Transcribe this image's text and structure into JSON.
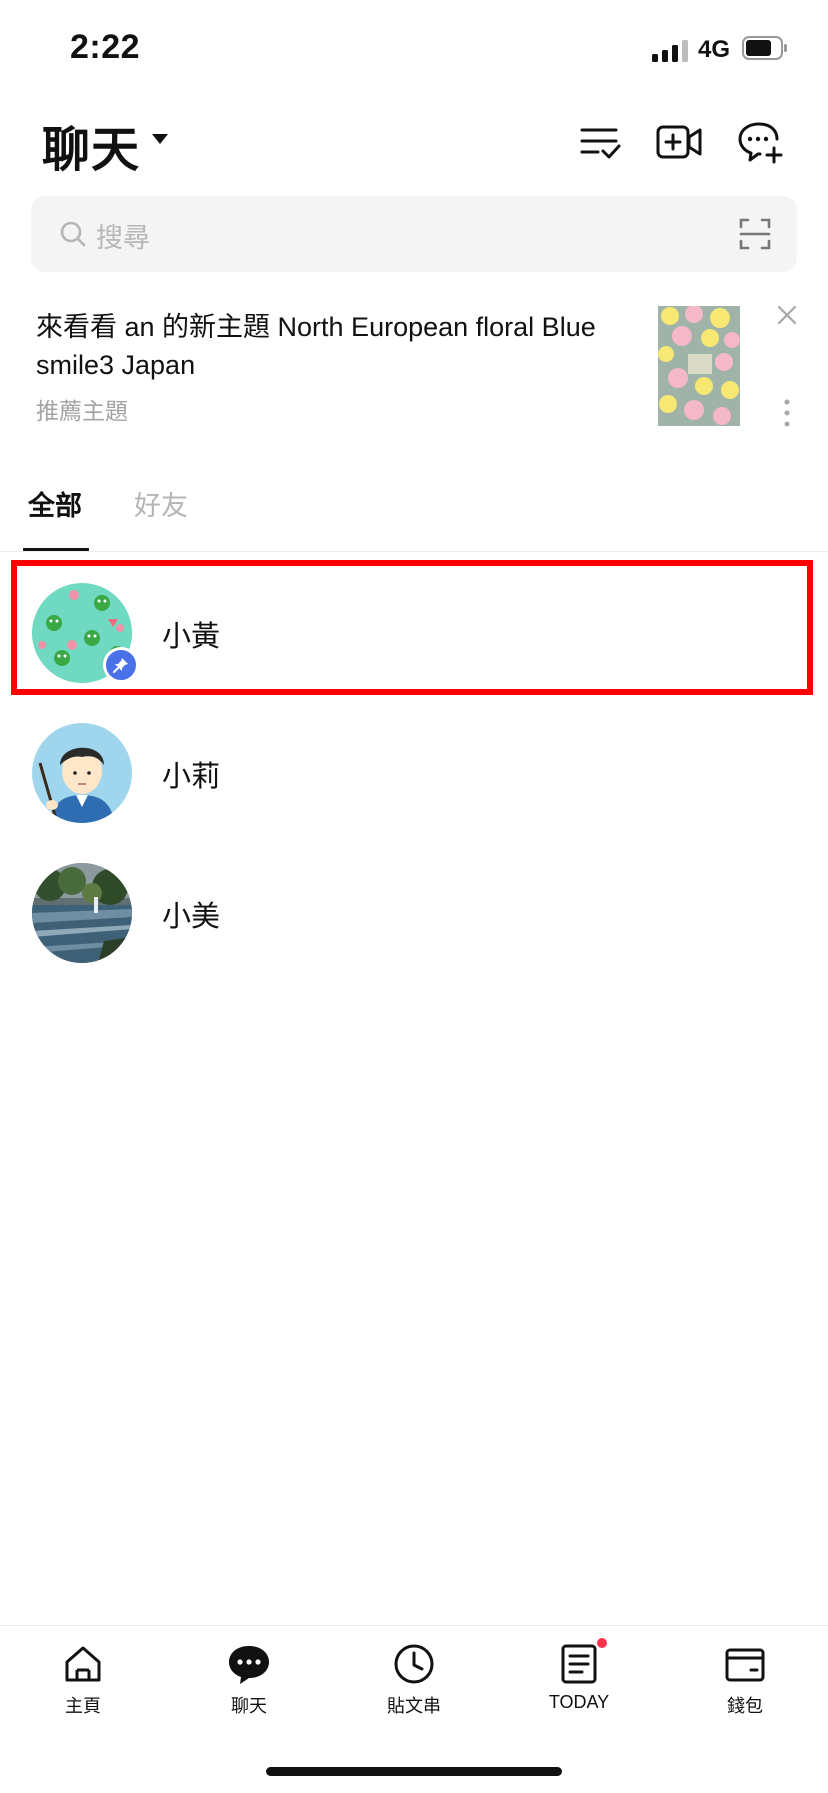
{
  "status_bar": {
    "time": "2:22",
    "network": "4G",
    "battery_percent": 70
  },
  "header": {
    "title": "聊天",
    "icons": [
      "edit-list-icon",
      "video-call-add-icon",
      "new-chat-icon"
    ]
  },
  "search": {
    "placeholder": "搜尋"
  },
  "promo": {
    "title": "來看看 an 的新主題 North European floral Blue smile3 Japan",
    "subtitle": "推薦主題"
  },
  "tabs": [
    {
      "label": "全部",
      "active": true
    },
    {
      "label": "好友",
      "active": false
    }
  ],
  "chats": [
    {
      "name": "小黃",
      "pinned": true
    },
    {
      "name": "小莉",
      "pinned": false
    },
    {
      "name": "小美",
      "pinned": false
    }
  ],
  "bottom_nav": [
    {
      "label": "主頁",
      "icon": "home-icon"
    },
    {
      "label": "聊天",
      "icon": "chat-bubble-icon",
      "active": true
    },
    {
      "label": "貼文串",
      "icon": "clock-icon"
    },
    {
      "label": "TODAY",
      "icon": "news-icon",
      "has_dot": true
    },
    {
      "label": "錢包",
      "icon": "wallet-icon"
    }
  ],
  "colors": {
    "accent_pin": "#4a71e8",
    "highlight": "#ff0000",
    "notification_dot": "#ff334b"
  }
}
